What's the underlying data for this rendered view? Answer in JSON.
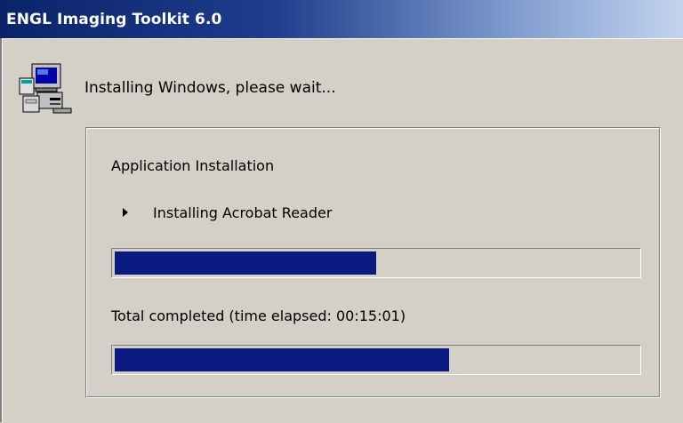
{
  "window": {
    "title": "ENGL Imaging Toolkit 6.0"
  },
  "header": {
    "message": "Installing Windows, please wait...",
    "icon": "setup-computer-icon"
  },
  "group": {
    "heading": "Application Installation",
    "current_item": {
      "icon": "play-arrow-icon",
      "label": "Installing Acrobat Reader"
    },
    "item_progress": {
      "fraction": 0.5
    },
    "total_label": "Total completed  (time elapsed: 00:15:01)",
    "total_progress": {
      "fraction": 0.64
    }
  },
  "colors": {
    "title_bar_start": "#0a246a",
    "title_bar_end": "#c4d4ef",
    "progress_fill": "#0a1a80",
    "window_bg": "#d4d0c8"
  }
}
